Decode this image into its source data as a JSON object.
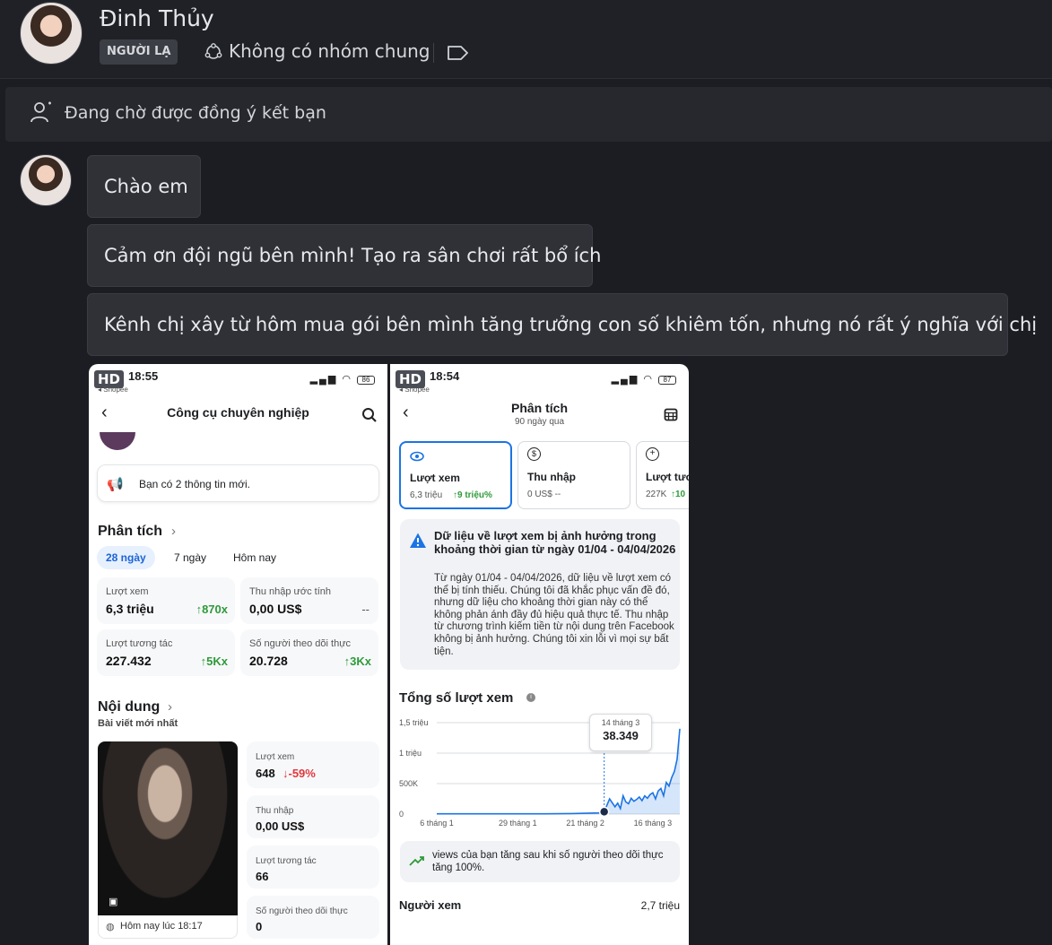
{
  "header": {
    "name": "Đinh Thủy",
    "badge": "NGƯỜI LẠ",
    "groups": "Không có nhóm chung"
  },
  "pending": {
    "text": "Đang chờ được đồng ý kết bạn"
  },
  "messages": [
    "Chào em",
    "Cảm ơn đội ngũ bên mình! Tạo ra sân chơi rất bổ ích",
    "Kênh chị xây từ hôm mua gói bên mình tăng trưởng con số khiêm tốn, nhưng nó rất ý nghĩa với chị"
  ],
  "shot1": {
    "hd": "HD",
    "shopee": "◂ Shopee",
    "time": "18:55",
    "battery": "86",
    "title": "Công cụ chuyên nghiệp",
    "notice": "Bạn có 2 thông tin mới.",
    "analytics_title": "Phân tích",
    "tabs": [
      "28 ngày",
      "7 ngày",
      "Hôm nay"
    ],
    "stats": [
      {
        "label": "Lượt xem",
        "value": "6,3 triệu",
        "delta": "↑870x"
      },
      {
        "label": "Thu nhập ước tính",
        "value": "0,00 US$",
        "delta": "--"
      },
      {
        "label": "Lượt tương tác",
        "value": "227.432",
        "delta": "↑5Kx"
      },
      {
        "label": "Số người theo dõi thực",
        "value": "20.728",
        "delta": "↑3Kx"
      }
    ],
    "content_title": "Nội dung",
    "content_sub": "Bài viết mới nhất",
    "post_time": "Hôm nay lúc 18:17",
    "post_stats": [
      {
        "label": "Lượt xem",
        "value": "648",
        "delta": "↓-59%"
      },
      {
        "label": "Thu nhập",
        "value": "0,00 US$",
        "delta": ""
      },
      {
        "label": "Lượt tương tác",
        "value": "66",
        "delta": ""
      },
      {
        "label": "Số người theo dõi thực",
        "value": "0",
        "delta": ""
      }
    ]
  },
  "shot2": {
    "hd": "HD",
    "shopee": "◂ Shopee",
    "time": "18:54",
    "battery": "87",
    "title": "Phân tích",
    "subtitle": "90 ngày qua",
    "metric_cards": [
      {
        "label": "Lượt xem",
        "sub": "6,3 triệu",
        "delta": "↑9 triệu%"
      },
      {
        "label": "Thu nhập",
        "sub": "0 US$ --",
        "delta": ""
      },
      {
        "label": "Lượt tươ",
        "sub": "227K",
        "delta": "↑10"
      }
    ],
    "notice_title": "Dữ liệu về lượt xem bị ảnh hưởng trong khoảng thời gian từ ngày 01/04 - 04/04/2026",
    "notice_body": "Từ ngày 01/04 - 04/04/2026, dữ liệu về lượt xem có thể bị tính thiếu. Chúng tôi đã khắc phục vấn đề đó, nhưng dữ liệu cho khoảng thời gian này có thể không phản ánh đầy đủ hiệu quả thực tế. Thu nhập từ chương trình kiếm tiền từ nội dung trên Facebook không bị ảnh hưởng. Chúng tôi xin lỗi vì mọi sự bất tiện.",
    "total_title": "Tổng số lượt xem",
    "insight": "views của bạn tăng sau khi số người theo dõi thực tăng 100%.",
    "viewers_label": "Người xem",
    "viewers_value": "2,7 triệu"
  },
  "chart_data": {
    "type": "area",
    "title": "",
    "yticks": [
      "1,5 triệu",
      "1 triệu",
      "500K",
      "0"
    ],
    "ylim": [
      0,
      1500000
    ],
    "xticks": [
      "6 tháng 1",
      "29 tháng 1",
      "21 tháng 2",
      "16 tháng 3"
    ],
    "tooltip": {
      "label": "14 tháng 3",
      "value": "38.349"
    },
    "x": [
      0,
      10,
      20,
      30,
      40,
      50,
      60,
      62,
      64,
      66,
      67,
      68,
      69,
      70,
      71,
      72,
      73,
      74,
      75,
      76,
      77,
      78,
      79,
      80,
      81,
      82,
      83,
      84,
      85,
      86,
      87,
      88,
      89,
      90
    ],
    "values": [
      5000,
      5000,
      5000,
      5000,
      5000,
      8000,
      20000,
      38349,
      250000,
      120000,
      180000,
      90000,
      300000,
      200000,
      170000,
      260000,
      210000,
      240000,
      280000,
      220000,
      300000,
      260000,
      320000,
      350000,
      250000,
      380000,
      420000,
      300000,
      520000,
      460000,
      600000,
      700000,
      900000,
      1400000
    ],
    "series_color": "#1b74e4",
    "grid": true
  },
  "colors": {
    "bg": "#1b1d22",
    "bubble": "#2f3137",
    "accent": "#1b74e4",
    "green": "#2e9a3a",
    "red": "#e0383e"
  }
}
